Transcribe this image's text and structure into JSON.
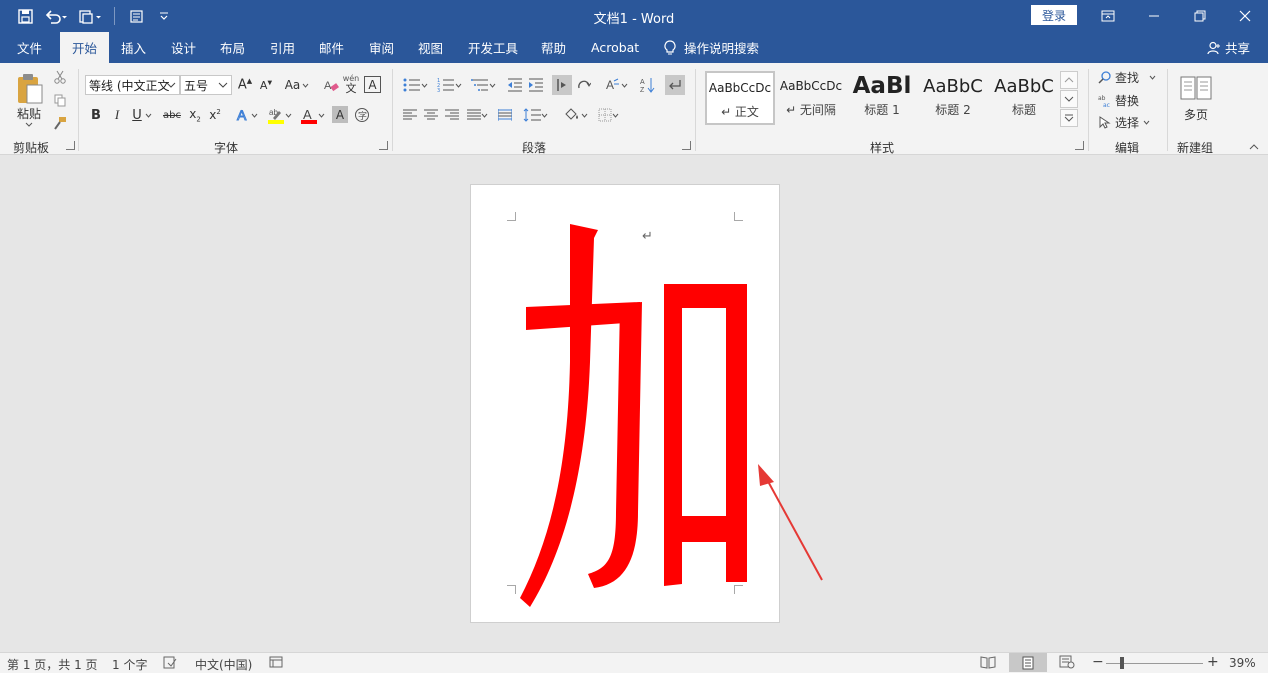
{
  "titlebar": {
    "title": "文档1 - Word",
    "login_label": "登录"
  },
  "tabs": [
    {
      "label": "文件"
    },
    {
      "label": "开始"
    },
    {
      "label": "插入"
    },
    {
      "label": "设计"
    },
    {
      "label": "布局"
    },
    {
      "label": "引用"
    },
    {
      "label": "邮件"
    },
    {
      "label": "审阅"
    },
    {
      "label": "视图"
    },
    {
      "label": "开发工具"
    },
    {
      "label": "帮助"
    },
    {
      "label": "Acrobat"
    }
  ],
  "tell_me": "操作说明搜索",
  "share_label": "共享",
  "ribbon": {
    "clipboard": {
      "paste_label": "粘贴",
      "group_label": "剪贴板"
    },
    "font": {
      "font_name": "等线 (中文正文",
      "font_size": "五号",
      "change_case": "Aa",
      "phonetic": "wén",
      "group_label": "字体"
    },
    "paragraph": {
      "group_label": "段落"
    },
    "styles": {
      "group_label": "样式",
      "items": [
        {
          "sample": "AaBbCcDc",
          "name": "↵ 正文"
        },
        {
          "sample": "AaBbCcDc",
          "name": "↵ 无间隔"
        },
        {
          "sample": "AaBl",
          "name": "标题 1"
        },
        {
          "sample": "AaBbC",
          "name": "标题 2"
        },
        {
          "sample": "AaBbC",
          "name": "标题"
        }
      ]
    },
    "editing": {
      "find_label": "查找",
      "replace_label": "替换",
      "select_label": "选择",
      "group_label": "编辑"
    },
    "newgroup": {
      "multipage_label": "多页",
      "group_label": "新建组"
    }
  },
  "document": {
    "character": "加",
    "char_color": "#ff0000",
    "paragraph_mark": "↵"
  },
  "statusbar": {
    "page_info": "第 1 页，共 1 页",
    "word_count": "1 个字",
    "language": "中文(中国)",
    "zoom_label": "39%",
    "zoom_percent": 39
  },
  "colors": {
    "brand": "#2b579a",
    "highlight": "#ffff00",
    "font_color": "#ff0000",
    "arrow": "#e53935"
  }
}
